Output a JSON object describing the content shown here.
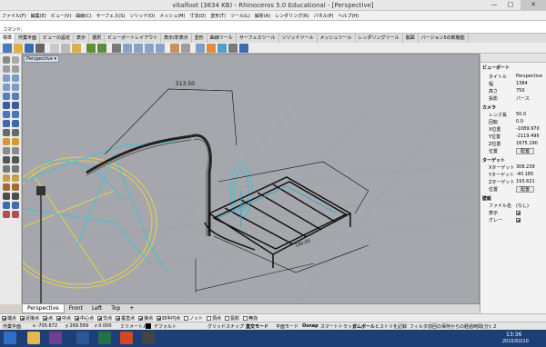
{
  "window": {
    "title": "vitalfoot (3834 KB) - Rhinoceros 5.0 Educational - [Perspective]",
    "minimize": "—",
    "maximize": "□",
    "close": "✕"
  },
  "menu": [
    "ファイル(F)",
    "編集(E)",
    "ビュー(V)",
    "曲線(C)",
    "サーフェス(S)",
    "ソリッド(O)",
    "メッシュ(M)",
    "寸法(D)",
    "変形(T)",
    "ツール(L)",
    "解析(A)",
    "レンダリング(R)",
    "パネル(P)",
    "ヘルプ(H)"
  ],
  "command": {
    "label": "コマンド:"
  },
  "tabs": [
    "標準",
    "作業平面",
    "ビューの設定",
    "表示",
    "選択",
    "ビューポートレイアウト",
    "表示/非表示",
    "変形",
    "曲線ツール",
    "サーフェスツール",
    "ソリッドツール",
    "メッシュツール",
    "レンダリングツール",
    "製図",
    "バージョン5の新機能"
  ],
  "viewport": {
    "label": "Perspective",
    "dimension_label": "513.50",
    "dimension_label2": "180.00"
  },
  "viewport_tabs": [
    "Perspective",
    "Front",
    "Left",
    "Top",
    "+"
  ],
  "osnap": [
    {
      "label": "端点",
      "on": true
    },
    {
      "label": "近接点",
      "on": true
    },
    {
      "label": "点",
      "on": true
    },
    {
      "label": "中点",
      "on": true
    },
    {
      "label": "中心点",
      "on": true
    },
    {
      "label": "交点",
      "on": true
    },
    {
      "label": "垂直点",
      "on": true
    },
    {
      "label": "接点",
      "on": true
    },
    {
      "label": "四半円点",
      "on": true
    },
    {
      "label": "ノット",
      "on": false
    },
    {
      "label": "頂点",
      "on": false
    },
    {
      "label": "投影",
      "on": false
    },
    {
      "label": "無効",
      "on": false
    }
  ],
  "status": {
    "plane": "作業平面",
    "x": "x -705.672",
    "y": "y 269.569",
    "z": "z 0.000",
    "unit": "ミリメートル",
    "layer": "デフォルト",
    "gridsnap": "グリッドスナップ",
    "ortho": "直交モード",
    "planar": "平面モード",
    "osnap": "Osnap",
    "smarttrack": "スマートトラック",
    "gumball": "ガムボール",
    "history": "ヒストリを記録",
    "filter": "フィルタ",
    "elapsed": "前回の保存からの経過時間(分): 2"
  },
  "right_panel": {
    "viewport_section": "ビューポート",
    "title_key": "タイトル",
    "title_val": "Perspective",
    "width_key": "幅",
    "width_val": "1384",
    "height_key": "高さ",
    "height_val": "750",
    "proj_key": "投影",
    "proj_val": "パース",
    "camera_section": "カメラ",
    "lens_key": "レンズ長",
    "lens_val": "50.0",
    "rot_key": "回転",
    "rot_val": "0.0",
    "xpos_key": "X位置",
    "xpos_val": "-1089.970",
    "ypos_key": "Y位置",
    "ypos_val": "-2119.496",
    "zpos_key": "Z位置",
    "zpos_val": "1675.190",
    "pos_key": "位置",
    "pos_btn": "配置",
    "target_section": "ターゲット",
    "tx_key": "Xターゲット",
    "tx_val": "308.239",
    "ty_key": "Yターゲット",
    "ty_val": "-40.185",
    "tz_key": "Zターゲット",
    "tz_val": "193.621",
    "tpos_key": "位置",
    "tpos_btn": "配置",
    "wall_section": "壁紙",
    "file_key": "ファイル名",
    "file_val": "(なし)",
    "show_key": "表示",
    "gray_key": "グレー"
  },
  "taskbar": {
    "time": "13:36",
    "date": "2015/02/10"
  }
}
